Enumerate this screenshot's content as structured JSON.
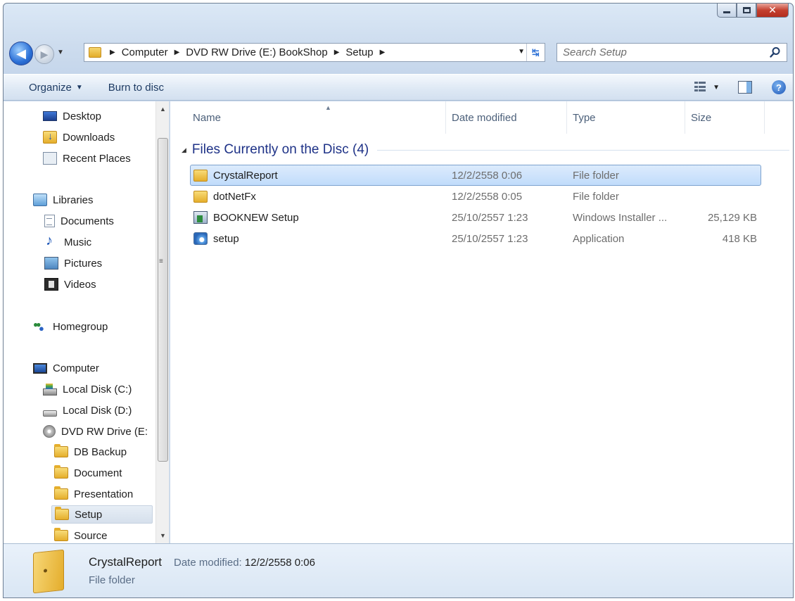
{
  "window": {
    "buttons": {
      "minimize": "minimize",
      "maximize": "maximize",
      "close": "✕"
    }
  },
  "address": {
    "crumbs": [
      "Computer",
      "DVD RW Drive (E:) BookShop",
      "Setup"
    ],
    "search_placeholder": "Search Setup"
  },
  "toolbar": {
    "organize_label": "Organize",
    "burn_label": "Burn to disc"
  },
  "nav": {
    "items": [
      {
        "label": "Desktop",
        "icon": "desktop-icon"
      },
      {
        "label": "Downloads",
        "icon": "downloads-icon"
      },
      {
        "label": "Recent Places",
        "icon": "recent-places-icon"
      },
      {
        "label": "Libraries",
        "icon": "libraries-icon"
      },
      {
        "label": "Documents",
        "icon": "documents-icon"
      },
      {
        "label": "Music",
        "icon": "music-icon"
      },
      {
        "label": "Pictures",
        "icon": "pictures-icon"
      },
      {
        "label": "Videos",
        "icon": "videos-icon"
      },
      {
        "label": "Homegroup",
        "icon": "homegroup-icon"
      },
      {
        "label": "Computer",
        "icon": "computer-icon"
      },
      {
        "label": "Local Disk (C:)",
        "icon": "local-disk-c-icon"
      },
      {
        "label": "Local Disk (D:)",
        "icon": "local-disk-d-icon"
      },
      {
        "label": "DVD RW Drive (E:",
        "icon": "dvd-drive-icon"
      },
      {
        "label": "DB Backup",
        "icon": "folder-icon"
      },
      {
        "label": "Document",
        "icon": "folder-icon"
      },
      {
        "label": "Presentation",
        "icon": "folder-icon"
      },
      {
        "label": "Setup",
        "icon": "folder-icon",
        "selected": true
      },
      {
        "label": "Source",
        "icon": "folder-icon"
      }
    ]
  },
  "columns": {
    "name": "Name",
    "date": "Date modified",
    "type": "Type",
    "size": "Size"
  },
  "group": {
    "title": "Files Currently on the Disc (4)"
  },
  "files": [
    {
      "name": "CrystalReport",
      "date": "12/2/2558 0:06",
      "type": "File folder",
      "size": "",
      "icon": "folder-icon",
      "selected": true
    },
    {
      "name": "dotNetFx",
      "date": "12/2/2558 0:05",
      "type": "File folder",
      "size": "",
      "icon": "folder-icon"
    },
    {
      "name": "BOOKNEW Setup",
      "date": "25/10/2557 1:23",
      "type": "Windows Installer ...",
      "size": "25,129 KB",
      "icon": "installer-icon"
    },
    {
      "name": "setup",
      "date": "25/10/2557 1:23",
      "type": "Application",
      "size": "418 KB",
      "icon": "application-icon"
    }
  ],
  "details": {
    "name": "CrystalReport",
    "date_label": "Date modified:",
    "date_value": "12/2/2558 0:06",
    "type": "File folder"
  },
  "colors": {
    "accent": "#1e3287",
    "selection": "#c1dcfb",
    "close_button": "#c4402f"
  }
}
